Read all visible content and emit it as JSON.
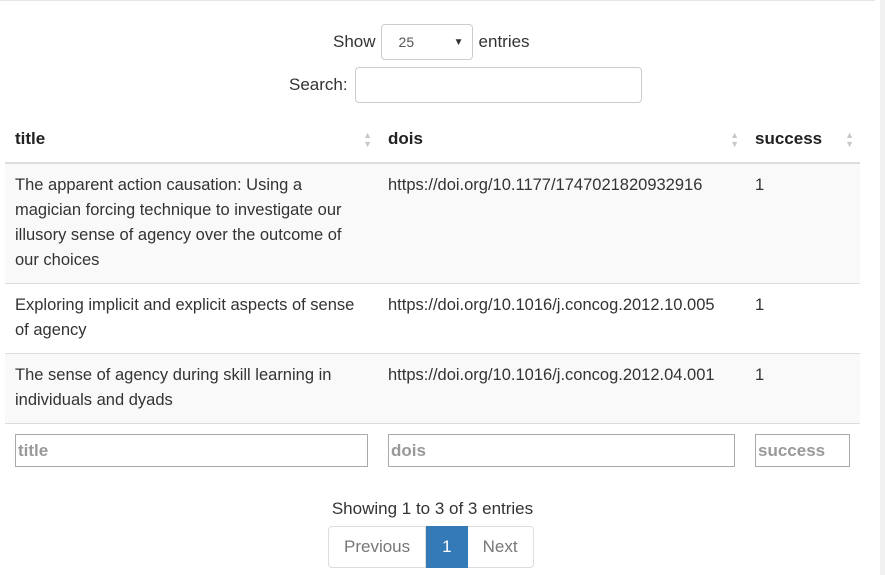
{
  "length_menu": {
    "show_label": "Show",
    "selected_value": "25",
    "entries_label": "entries"
  },
  "search": {
    "label": "Search:",
    "value": ""
  },
  "table": {
    "columns": [
      "title",
      "dois",
      "success"
    ],
    "rows": [
      {
        "title": "The apparent action causation: Using a magician forcing technique to investigate our illusory sense of agency over the outcome of our choices",
        "dois": "https://doi.org/10.1177/1747021820932916",
        "success": "1"
      },
      {
        "title": "Exploring implicit and explicit aspects of sense of agency",
        "dois": "https://doi.org/10.1016/j.concog.2012.10.005",
        "success": "1"
      },
      {
        "title": "The sense of agency during skill learning in individuals and dyads",
        "dois": "https://doi.org/10.1016/j.concog.2012.04.001",
        "success": "1"
      }
    ],
    "filter_placeholders": [
      "title",
      "dois",
      "success"
    ]
  },
  "info": "Showing 1 to 3 of 3 entries",
  "pagination": {
    "previous": "Previous",
    "current": "1",
    "next": "Next"
  },
  "icons": {
    "sort": "sort-both-icon",
    "caret": "chevron-down-icon"
  },
  "colors": {
    "accent": "#337ab7",
    "stripe": "#f9f9f9",
    "border": "#dddddd"
  }
}
